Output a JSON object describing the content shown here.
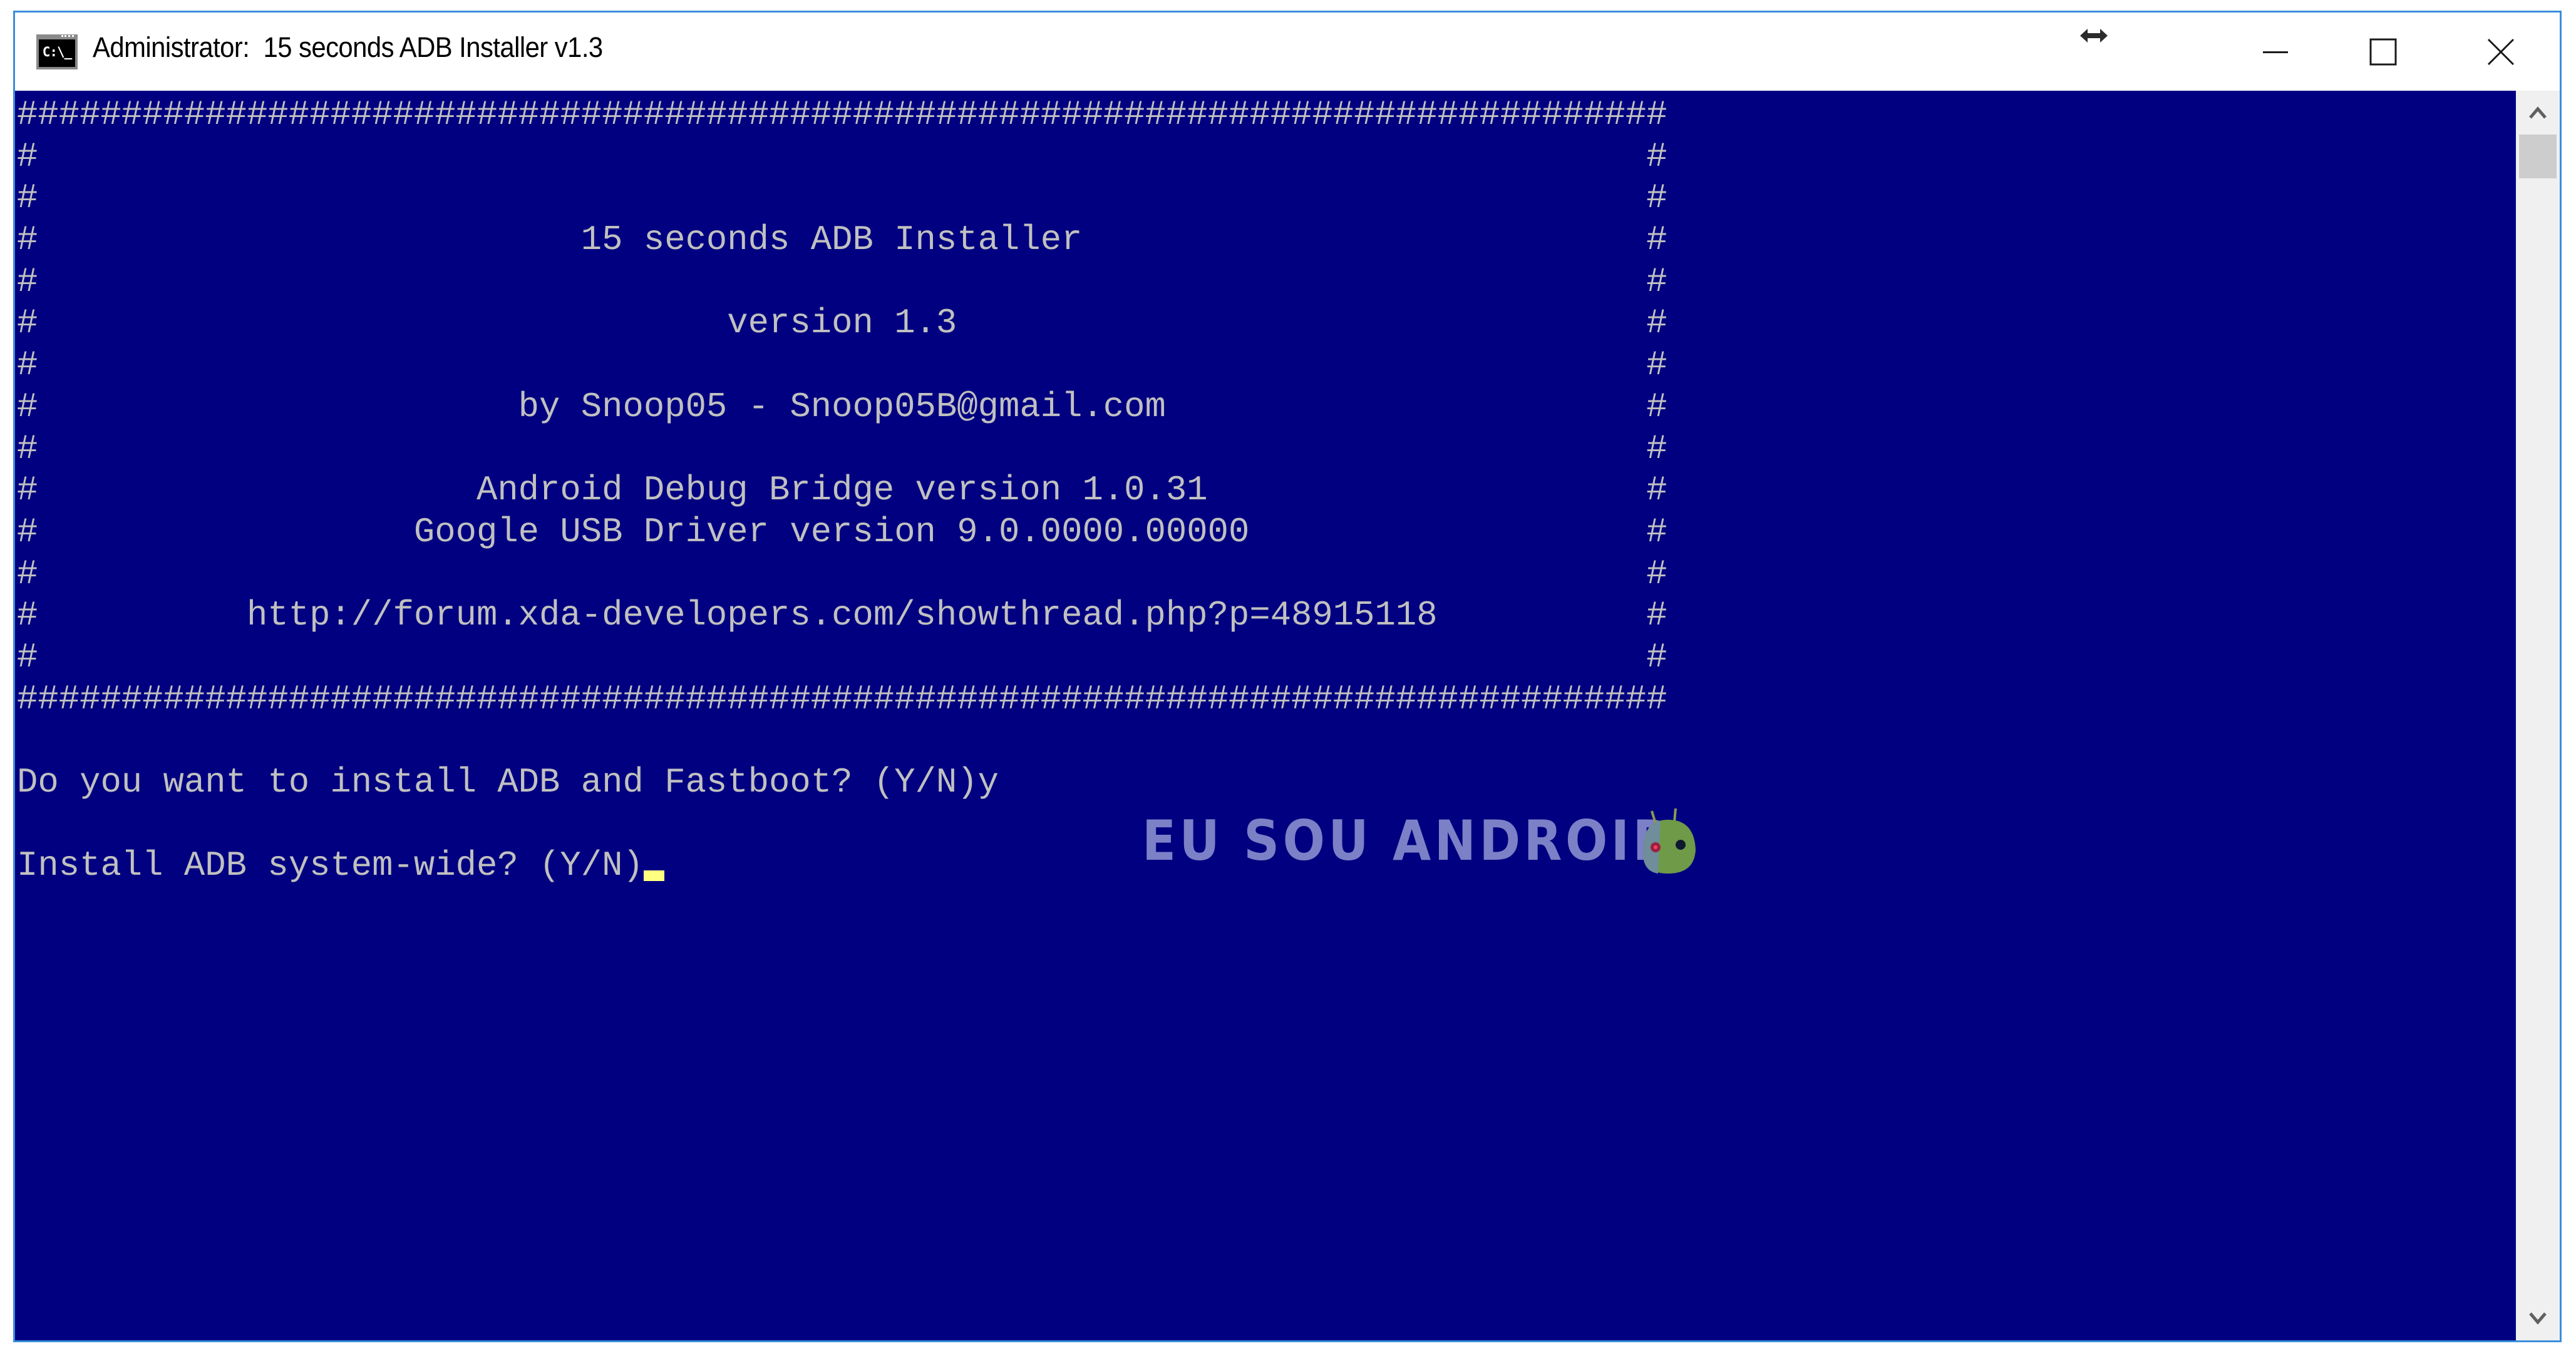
{
  "window": {
    "title": "Administrator:  15 seconds ADB Installer v1.3",
    "icon": "cmd-console-icon",
    "icon_label": "C:\\_",
    "caption_buttons": {
      "resize": "resize-horizontal-icon",
      "minimize": "minimize-icon",
      "maximize": "maximize-icon",
      "close": "close-icon"
    }
  },
  "colors": {
    "console_background": "#000080",
    "console_text": "#c0c0c0",
    "cursor": "#ffff80",
    "window_border": "#3b8edb"
  },
  "console": {
    "lines": [
      "###############################################################################",
      "#                                                                             #",
      "#                                                                             #",
      "#                          15 seconds ADB Installer                           #",
      "#                                                                             #",
      "#                                 version 1.3                                 #",
      "#                                                                             #",
      "#                       by Snoop05 - Snoop05B@gmail.com                       #",
      "#                                                                             #",
      "#                     Android Debug Bridge version 1.0.31                     #",
      "#                  Google USB Driver version 9.0.0000.00000                   #",
      "#                                                                             #",
      "#          http://forum.xda-developers.com/showthread.php?p=48915118          #",
      "#                                                                             #",
      "###############################################################################",
      "",
      "Do you want to install ADB and Fastboot? (Y/N)y",
      "",
      "Install ADB system-wide? (Y/N)"
    ],
    "cursor_line": 18
  },
  "watermark": {
    "text": "EU SOU ANDROID",
    "mascot": "android-mascot-icon"
  },
  "scrollbar": {
    "up": "chevron-up-icon",
    "down": "chevron-down-icon"
  }
}
